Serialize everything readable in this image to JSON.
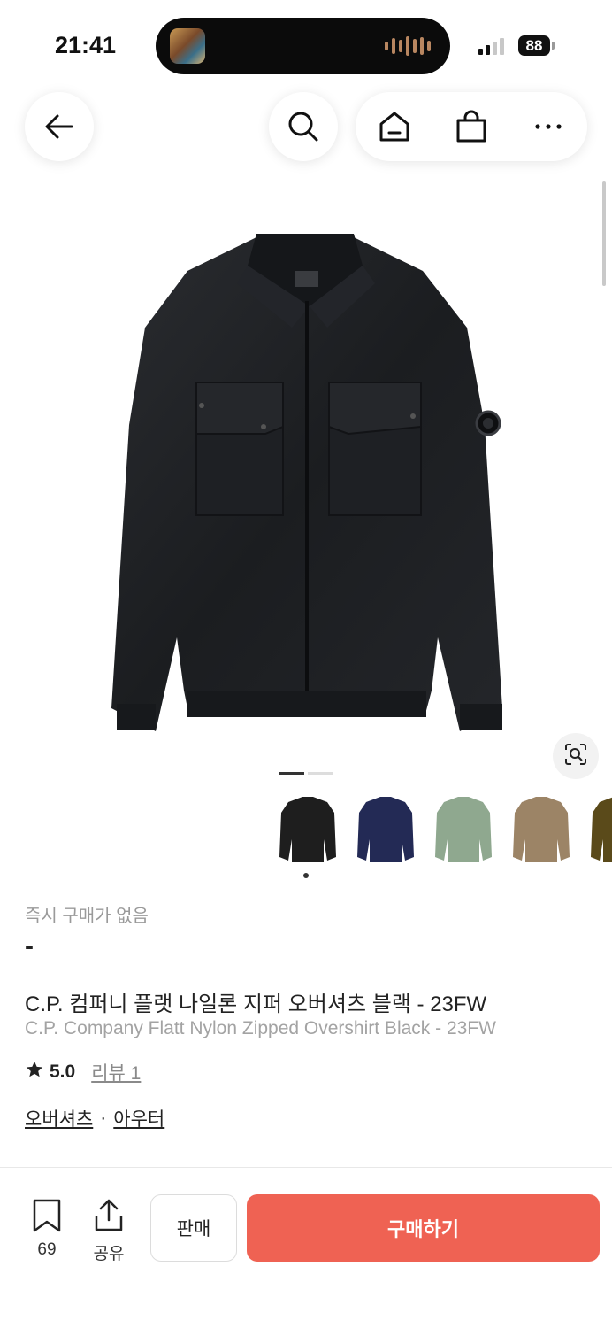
{
  "status_bar": {
    "time": "21:41",
    "battery": "88"
  },
  "nav": {
    "back_icon": "arrow-left-icon",
    "search_icon": "search-icon",
    "home_icon": "home-icon",
    "bag_icon": "shopping-bag-icon",
    "more_icon": "more-horizontal-icon"
  },
  "gallery": {
    "page_count": 2,
    "current_page": 1
  },
  "thumbnails": [
    {
      "color_name": "black",
      "color": "#1e1e1e"
    },
    {
      "color_name": "navy",
      "color": "#232a55"
    },
    {
      "color_name": "sage",
      "color": "#8fa88f"
    },
    {
      "color_name": "khaki",
      "color": "#9c8466"
    },
    {
      "color_name": "olive",
      "color": "#5a4a1a"
    }
  ],
  "product": {
    "instant_buy_status": "즉시 구매가 없음",
    "price": "-",
    "title_ko": "C.P. 컴퍼니 플랫 나일론 지퍼 오버셔츠 블랙 - 23FW",
    "title_en": "C.P. Company Flatt Nylon Zipped Overshirt Black - 23FW",
    "rating": "5.0",
    "review_link": "리뷰 1",
    "category_1": "오버셔츠",
    "category_sep": "·",
    "category_2": "아우터"
  },
  "bottom_bar": {
    "bookmark_count": "69",
    "share_label": "공유",
    "sell_label": "판매",
    "buy_label": "구매하기",
    "buy_color": "#ef6253"
  }
}
